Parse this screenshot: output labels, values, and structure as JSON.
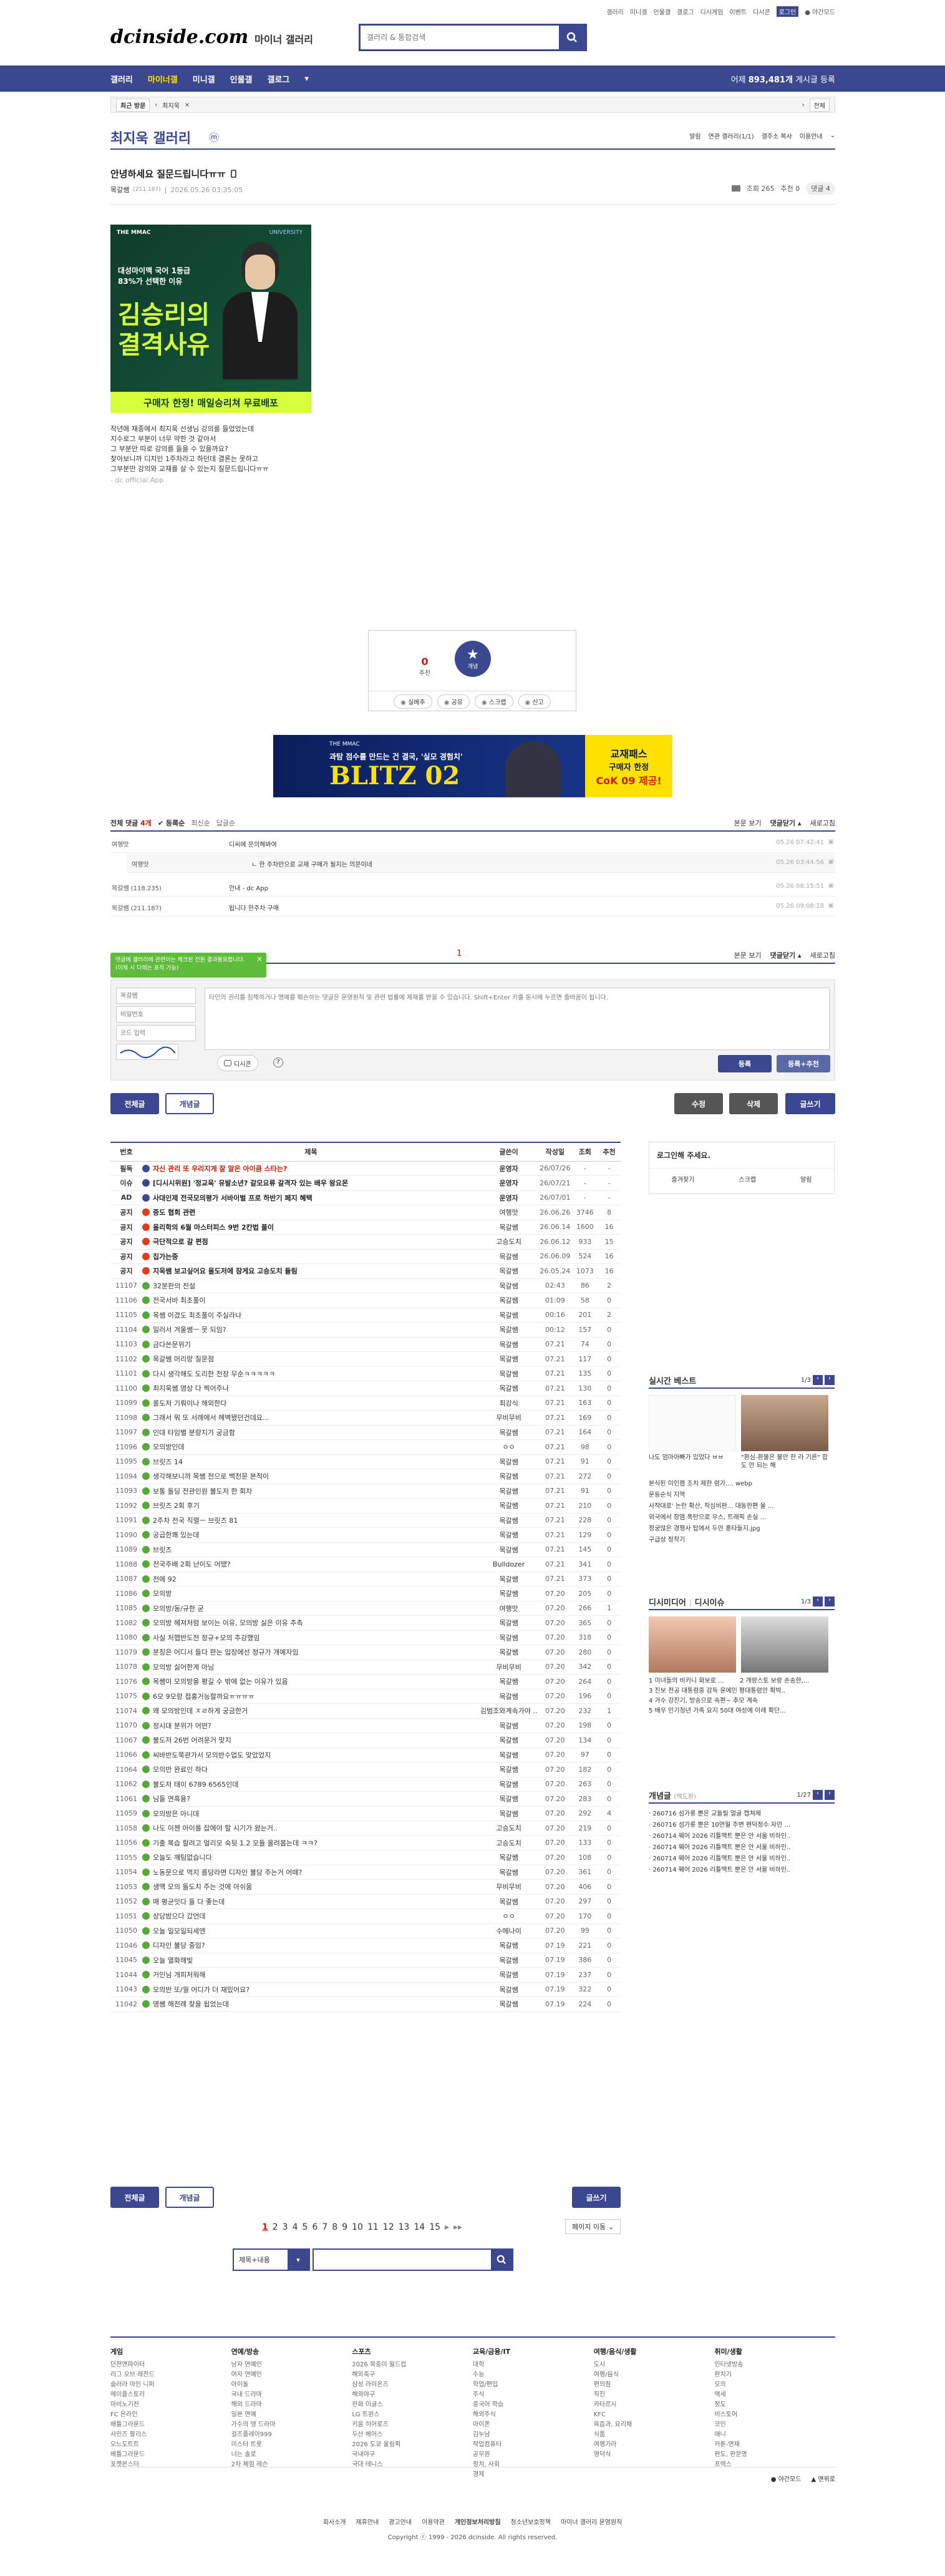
{
  "top_links": [
    "갤러리",
    "미니갤",
    "인물갤",
    "갤로그",
    "디시게임",
    "이벤트",
    "디시콘"
  ],
  "top_login": "로그인",
  "top_night": "야간모드",
  "logo": {
    "text": "dcinside.com",
    "sub": "마이너 갤러리"
  },
  "search": {
    "placeholder": "갤러리 & 통합검색"
  },
  "gnb": {
    "items": [
      "갤러리",
      "마이너갤",
      "미니갤",
      "인물갤",
      "갤로그"
    ],
    "right_prefix": "어제",
    "right_count": "893,481개",
    "right_suffix": "게시글 등록"
  },
  "crumb": {
    "recent": "최근 방문",
    "current": "최지욱",
    "all": "전체"
  },
  "gallery": {
    "title": "최지욱 갤러리",
    "badge": "ⓜ",
    "actions": [
      "알림",
      "연관 갤러리(1/1)",
      "갤주소 복사",
      "이용안내"
    ]
  },
  "post": {
    "title": "안녕하세요 질문드립니다ㅠㅠ",
    "author": "목갈쌤",
    "author_ip": "(211.187)",
    "date": "2026.05.26 03:35:05",
    "views": "조회 265",
    "recommends": "추천 0",
    "comments": "댓글 4",
    "body": [
      "작년에 재종에서 최지욱 선생님 강의를 들었었는데",
      "지수로그 부분이 너무 약한 것 같아서",
      "그 부분만 따로 강의를 들을 수 있을까요?",
      "찾아보니까 디지인 1주차라고 하던데 결론는 못하고",
      "그부분만 강의와 교재를 살 수 있는지 질문드립니다ㅠㅠ"
    ],
    "sign": "- dc official App"
  },
  "ad1": {
    "brand": "THE MMAC",
    "brand2": "UNIVERSITY",
    "line1": "대성마이맥 국어 1등급",
    "line2": "83%가 선택한 이유",
    "big1": "김승리의",
    "big2": "결격사유",
    "cta": "구매자 한정! 매일승리쳐 무료배포"
  },
  "vote": {
    "up_count": "0",
    "up_label": "추천",
    "down_label": "개념",
    "actions": [
      "실베추",
      "공유",
      "스크랩",
      "신고"
    ]
  },
  "ad2": {
    "brand": "THE MMAC",
    "line": "과탐 점수를 만드는 건 결국, '실모 경험치'",
    "big": "BLITZ 02",
    "right1": "교재패스",
    "right2": "구매자 한정",
    "right3": "CoK 09 제공!"
  },
  "comments_bar": {
    "label": "전체 댓글",
    "count": "4개",
    "filters": [
      "등록순",
      "최신순",
      "답글순"
    ],
    "right": [
      "본문 보기",
      "댓글닫기",
      "새로고침"
    ]
  },
  "comments": [
    {
      "name": "여행맛",
      "text": "디씨에 문의해봐여",
      "date": "05.26 07:42:41",
      "reply": false
    },
    {
      "name": "여행맛",
      "text": "ㄴ 한 주차만으로 교재 구매가 될지는 의문이네",
      "date": "05.26 03:44:56",
      "reply": true
    },
    {
      "name": "목갈쌤",
      "ip": "(118.235)",
      "text": "안내 - dc App",
      "date": "05.26 08:15:51",
      "reply": false
    },
    {
      "name": "목갈쌤",
      "ip": "(211.187)",
      "text": "됩니다 한주차 구매",
      "date": "05.26 09:08:18",
      "reply": false
    }
  ],
  "page_mark": "1",
  "tooltip": "댓글에 갤러리에 관련이는 체크된 전원 결과필요합니다. (이제 시 다레는 표적 가능)",
  "write": {
    "name_ph": "목갈쌤",
    "pw_ph": "비밀번호",
    "code_ph": "코드 입력",
    "text_ph": "타인의 권리를 침해하거나 명예를 훼손하는 댓글은 운영원칙 및 관련 법률에 제재를 받을 수 있습니다. Shift+Enter 키를 동시에 누르면 줄바꿈이 됩니다.",
    "dccon": "디시콘",
    "submit": "등록",
    "submit2": "등록+추천"
  },
  "list_tabs": {
    "all": "전체글",
    "concept": "개념글",
    "btn1": "수정",
    "btn2": "삭제",
    "write": "글쓰기"
  },
  "list_head": [
    "번호",
    "제목",
    "글쓴이",
    "작성일",
    "조회",
    "추천"
  ],
  "list": [
    [
      "필독",
      "자신 관리 또 우리지게 잘 알은 아이큼 스타는?",
      "운영자",
      "26/07/26",
      "-",
      "-",
      "n"
    ],
    [
      "이슈",
      "[디시시위원] '정교육' 유발소년? 갈모요류 갈격자 있는 배우 왕요몬",
      "운영자",
      "26/07/21",
      "-",
      "-",
      "n"
    ],
    [
      "AD",
      "사대인제 전국모의평가 서바이벌 프로 하반기 페지 혜택",
      "운영자",
      "26/07/01",
      "-",
      "-",
      "n"
    ],
    [
      "공지",
      "중도 협회 관련",
      "여행맛",
      "26.06.26",
      "3746",
      "8",
      "r"
    ],
    [
      "공지",
      "올리학의 6월 마스터피스 9번 2칸법 풀이",
      "목갈쌤",
      "26.06.14",
      "1600",
      "16",
      "r"
    ],
    [
      "공지",
      "극단적으로 갈 편점",
      "고승도치",
      "26.06.12",
      "933",
      "15",
      "r"
    ],
    [
      "공지",
      "집가는중",
      "목갈쌤",
      "26.06.09",
      "524",
      "16",
      "r"
    ],
    [
      "공지",
      "지욱쌤 보고싶어요 올도저에 잠게요 고승도치 들림",
      "목갈쌤",
      "26.05.24",
      "1073",
      "16",
      "r"
    ],
    [
      "11107",
      "32분판의 전설",
      "목갈쌤",
      "02:43",
      "86",
      "2",
      "g"
    ],
    [
      "11106",
      "전국서바 최초풀이",
      "목갈쌤",
      "01:09",
      "58",
      "0",
      "g"
    ],
    [
      "11105",
      "목쌤 이겼도 최초풀이 주실라나",
      "목갈쌤",
      "00:16",
      "201",
      "2",
      "g"
    ],
    [
      "11104",
      "일러서 겨울쌤ㅡ 뭇 되임?",
      "목갈쌤",
      "00:12",
      "157",
      "0",
      "g"
    ],
    [
      "11103",
      "금다쓴문위기",
      "목갈쌤",
      "07.21",
      "74",
      "0",
      "g"
    ],
    [
      "11102",
      "목갈쌤 머리랑 질문점",
      "목갈쌤",
      "07.21",
      "117",
      "0",
      "g"
    ],
    [
      "11101",
      "다시 생각해도 도리한 천장 무순ㅋㅋㅋㅋㅋ",
      "목갈쌤",
      "07.21",
      "135",
      "0",
      "g"
    ],
    [
      "11100",
      "최지욱쌤 영상 다 찍어주나",
      "목갈쌤",
      "07.21",
      "130",
      "0",
      "g"
    ],
    [
      "11099",
      "롤도저 기뤄이나 해외한다",
      "최강식",
      "07.21",
      "163",
      "0",
      "g"
    ],
    [
      "11098",
      "그래서 뭐 또 서례에서 헤벽됐던건데요...",
      "무비무비",
      "07.21",
      "169",
      "0",
      "g"
    ],
    [
      "11097",
      "인대 타임별 분량지가 궁금함",
      "목갈쌤",
      "07.21",
      "164",
      "0",
      "g"
    ],
    [
      "11096",
      "모의방인데",
      "ㅇㅇ",
      "07.21",
      "98",
      "0",
      "g"
    ],
    [
      "11095",
      "브릿즈 14",
      "목갈쌤",
      "07.21",
      "91",
      "0",
      "g"
    ],
    [
      "11094",
      "생각해보니까 목쌤 전으로 백천문 본적이",
      "목갈쌤",
      "07.21",
      "272",
      "0",
      "g"
    ],
    [
      "11093",
      "보통 돌딩 전관인원 불도저 한 회차",
      "목갈쌤",
      "07.21",
      "91",
      "0",
      "g"
    ],
    [
      "11092",
      "브릿즈 2회 후기",
      "목갈쌤",
      "07.21",
      "210",
      "0",
      "g"
    ],
    [
      "11091",
      "2주차 전국 직렬ㅡ 브릿즈 81",
      "목갈쌤",
      "07.21",
      "228",
      "0",
      "g"
    ],
    [
      "11090",
      "공급한쾌 있는데",
      "목갈쌤",
      "07.21",
      "129",
      "0",
      "g"
    ],
    [
      "11089",
      "브릿즈",
      "목갈쌤",
      "07.21",
      "145",
      "0",
      "g"
    ],
    [
      "11088",
      "전국주배 2회 난이도 어땠?",
      "Bulldozer",
      "07.21",
      "341",
      "0",
      "g"
    ],
    [
      "11087",
      "전에 92",
      "목갈쌤",
      "07.21",
      "373",
      "0",
      "g"
    ],
    [
      "11086",
      "모의방",
      "목갈쌤",
      "07.20",
      "205",
      "0",
      "g"
    ],
    [
      "11085",
      "모의방/동/규한 굳",
      "여행맛",
      "07.20",
      "266",
      "1",
      "g"
    ],
    [
      "11082",
      "모의방 헤져처럼 보이는 이유, 모의방 싫은 이유 추측",
      "목갈쌤",
      "07.20",
      "365",
      "0",
      "g"
    ],
    [
      "11080",
      "사실 처햅반도전 정규+모의 추강했임",
      "목갈쌤",
      "07.20",
      "318",
      "0",
      "g"
    ],
    [
      "11079",
      "분칭은 어디서 들다 판는 입장에선 정규가 개예자임",
      "목갈쌤",
      "07.20",
      "280",
      "0",
      "g"
    ],
    [
      "11078",
      "모의방 싫어한게 아님",
      "무비무비",
      "07.20",
      "342",
      "0",
      "g"
    ],
    [
      "11076",
      "목쌤이 모의방을 평길 수 밖에 없는 이유가 있음",
      "목갈쌤",
      "07.20",
      "264",
      "0",
      "g"
    ],
    [
      "11075",
      "6모 9모랑 접홍거능할까요ㅠㅠㅠㅠ",
      "목갈쌤",
      "07.20",
      "196",
      "0",
      "g"
    ],
    [
      "11074",
      "왜 모의방인데 ㅈㄹ하게 궁금한거",
      "김범조와계속가야 ..",
      "07.20",
      "232",
      "1",
      "g"
    ],
    [
      "11070",
      "정시대 분위가 어떤?",
      "목갈쌤",
      "07.20",
      "198",
      "0",
      "g"
    ],
    [
      "11067",
      "불도저 26번 어려운거 맞지",
      "목갈쌤",
      "07.20",
      "134",
      "0",
      "g"
    ],
    [
      "11066",
      "씨바반도쭉관가서 모의반수업도 맞았었지",
      "목갈쌤",
      "07.20",
      "97",
      "0",
      "g"
    ],
    [
      "11064",
      "모의반 완료인 하다",
      "목갈쌤",
      "07.20",
      "182",
      "0",
      "g"
    ],
    [
      "11062",
      "불도저 태이 6789 6565인데",
      "목갈쌤",
      "07.20",
      "263",
      "0",
      "g"
    ],
    [
      "11061",
      "님들 연흑용?",
      "목갈쌤",
      "07.20",
      "283",
      "0",
      "g"
    ],
    [
      "11059",
      "모의방은 아니데",
      "목갈쌤",
      "07.20",
      "292",
      "4",
      "g"
    ],
    [
      "11058",
      "나도 이젠 아이를 잡에야 할 시기가 왔는거..",
      "고승도치",
      "07.20",
      "219",
      "0",
      "g"
    ],
    [
      "11056",
      "기출 복습 할려고 얼리모 숙뒷 1.2 모듈 올려봅는데 ㅋㅋ?",
      "고승도치",
      "07.20",
      "133",
      "0",
      "g"
    ],
    [
      "11055",
      "오늘도 깨팀없습니다",
      "목갈쌤",
      "07.20",
      "108",
      "0",
      "g"
    ],
    [
      "11054",
      "노동문으로 먹지 를당라면 디자인 불당 주는거 어떼?",
      "목갈쌤",
      "07.20",
      "361",
      "0",
      "g"
    ],
    [
      "11053",
      "생맥 모의 돌도치 주는 것에 아쉬움",
      "무비무비",
      "07.20",
      "406",
      "0",
      "g"
    ],
    [
      "11052",
      "매 평균잇다 들 다 좋는데",
      "목갈쌤",
      "07.20",
      "297",
      "0",
      "g"
    ],
    [
      "11051",
      "상당밤으다 갔언데",
      "ㅇㅇ",
      "07.20",
      "170",
      "0",
      "g"
    ],
    [
      "11050",
      "오늘 일모일되세엔",
      "수메나이",
      "07.20",
      "99",
      "0",
      "g"
    ],
    [
      "11046",
      "디자인 불당 중임?",
      "목갈쌤",
      "07.19",
      "221",
      "0",
      "g"
    ],
    [
      "11045",
      "오늘 열화해빛",
      "목갈쌤",
      "07.19",
      "386",
      "0",
      "g"
    ],
    [
      "11044",
      "거인님 개피처워해",
      "목갈쌤",
      "07.19",
      "237",
      "0",
      "g"
    ],
    [
      "11043",
      "모의반 또/월 어디가 더 재밌어요?",
      "목갈쌤",
      "07.19",
      "322",
      "0",
      "g"
    ],
    [
      "11042",
      "영쌤 해전례 찾을 됩었는데",
      "목갈쌤",
      "07.19",
      "224",
      "0",
      "g"
    ]
  ],
  "pager": {
    "pages": [
      "1",
      "2",
      "3",
      "4",
      "5",
      "6",
      "7",
      "8",
      "9",
      "10",
      "11",
      "12",
      "13",
      "14",
      "15"
    ],
    "next": "▸",
    "last": "▸▸",
    "jump": "페이지 이동"
  },
  "bottom_search": {
    "select": "제목+내용",
    "placeholder": ""
  },
  "side": {
    "login_title": "로그인해 주세요.",
    "login_links": [
      "즐겨찾기",
      "스크랩",
      "알림"
    ],
    "realtime_title": "실시간 베스트",
    "realtime_page": "1/3",
    "realtime_thumb1": "나도 엄마아빠가 있었다 ㅂㅂ",
    "realtime_thumb2": "\"환심-환불은 불만 한 라 기른\" 합도 안 되는 해",
    "realtime_list": [
      "본식된 이인캠 조치 제한 령가.... webp",
      "운동순식 지역",
      "사작대로' 논란 확산, 작심비판... 대동한편 울 ...",
      "외국에서 장염 폭탄으로 우스, 트래픽 손실 ...",
      "정궁많은 경쟁사 탑에서 두만 홍타들지.jpg",
      "구급상 정착기"
    ],
    "dt_title": "디시미디어",
    "dt_title2": "디시이슈",
    "dt_page": "1/3",
    "dt_items": [
      "1 미녀들의 비키니 화보로 ...",
      "2 개량스토 보랑 손송한,...",
      "3 진보 전공 대통령중 감독 윤에인 평대통령안 확박..",
      "4 가수 강진기, 방송으로 속편~ 추모 계속",
      "5 배우 인기청년 가족 요지 50대 여성에 이례 확단..."
    ],
    "concept_title": "개념글",
    "concept_sub": "(백도원)",
    "concept_page": "1/27",
    "concept_list": [
      "260716 섬가롱 뿐은 교돌릴 얼굴 캡쳐제",
      "260716 섬가롱 뿐은 10연월 주변 펜덕정수 자민 ...",
      "260714 웨어 2026 리틀맥트 뿐은 안 서울 비하인..",
      "260714 웨어 2026 리틀맥트 뿐은 안 서울 비하인..",
      "260714 웨어 2026 리틀맥트 뿐은 안 서울 비하인..",
      "260714 웨어 2026 리틀맥트 뿐은 안 서울 비하인.."
    ]
  },
  "footer": {
    "cols": [
      {
        "title": "게임",
        "items": [
          "던전앤파이터",
          "리그 오브 레전드",
          "슬러라 마인 니퍼",
          "메이플스토리",
          "마비노기천",
          "FC 온라인",
          "배틀그라운드",
          "사인즈 팔리스",
          "오느도트트",
          "배틀그라운드",
          "포켓몬스터"
        ]
      },
      {
        "title": "연예/방송",
        "items": [
          "남자 연예인",
          "여자 연예인",
          "아이돌",
          "국내 드라마",
          "해외 드라마",
          "일본 연예",
          "가수의 앵 드라마",
          "걸즈플레이999",
          "미스터 트롯",
          "너는 솔로",
          "2차 체험 레슨"
        ]
      },
      {
        "title": "스포츠",
        "items": [
          "2026 북중미 월드컵",
          "해외축구",
          "삼성 라이온즈",
          "해외야구",
          "한화 이글스",
          "LG 트윈스",
          "키움 히어로즈",
          "두산 베어스",
          "2026 도쿄 올림픽",
          "국내야구",
          "국대 테니스"
        ]
      },
      {
        "title": "교육/금융/IT",
        "items": [
          "대학",
          "수능",
          "학업/편입",
          "주식",
          "중국어 학습",
          "해외주식",
          "아이폰",
          "김누남",
          "작업컴퓨터",
          "공무원",
          "정치, 사회",
          "경제"
        ]
      },
      {
        "title": "여행/음식/생활",
        "items": [
          "도시",
          "여행/음식",
          "편의점",
          "직진",
          "카타르시",
          "KFC",
          "육즙과, 요리채",
          "식품",
          "여행가라",
          "영덕식"
        ]
      },
      {
        "title": "취미/생활",
        "items": [
          "인터넷방송",
          "판치기",
          "모의",
          "액세",
          "정도",
          "비스토어",
          "코인",
          "애니",
          "카툰-연재",
          "판도, 판문명",
          "프렉스"
        ]
      }
    ],
    "night": "야간모드",
    "top": "맨위로",
    "links": [
      "회사소개",
      "제휴안내",
      "광고안내",
      "이용약관",
      "개인정보처리방침",
      "청소년보호정책",
      "마이너 갤러리 운영원칙"
    ],
    "copyright": "Copyright ⓒ 1999 - 2026 dcinside. All rights reserved."
  }
}
